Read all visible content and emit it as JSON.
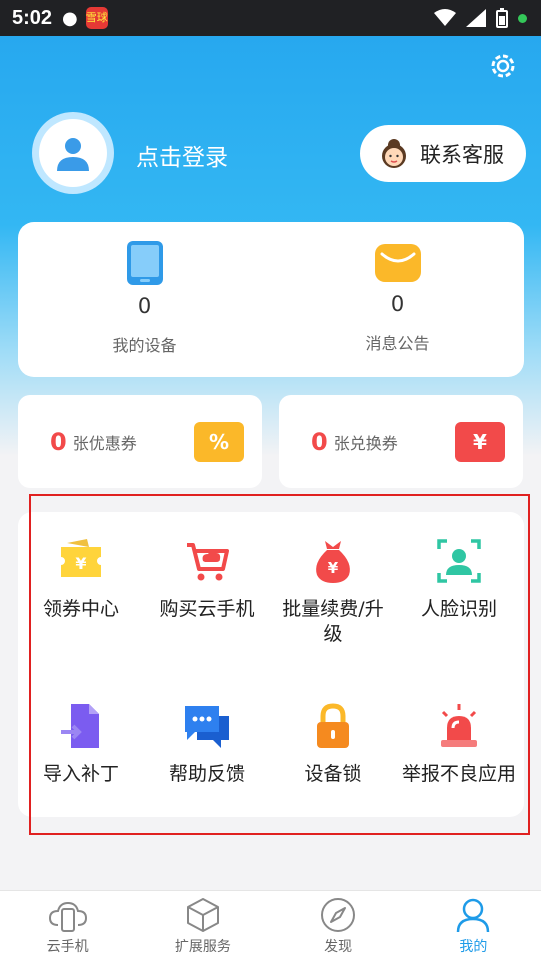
{
  "status_bar": {
    "time": "5:02",
    "app_badge": "雪球"
  },
  "header": {
    "login_text": "点击登录",
    "customer_service": "联系客服"
  },
  "stats": [
    {
      "value": "0",
      "label": "我的设备"
    },
    {
      "value": "0",
      "label": "消息公告"
    }
  ],
  "coupons": [
    {
      "value": "0",
      "label": "张优惠券",
      "tag": "%",
      "color": "#fbb829"
    },
    {
      "value": "0",
      "label": "张兑换券",
      "tag": "¥",
      "color": "#f24a4a"
    }
  ],
  "grid_items": [
    {
      "label": "领券中心",
      "icon": "ticket-icon"
    },
    {
      "label": "购买云手机",
      "icon": "cart-icon"
    },
    {
      "label": "批量续费/升级",
      "icon": "money-bag-icon"
    },
    {
      "label": "人脸识别",
      "icon": "face-scan-icon"
    },
    {
      "label": "导入补丁",
      "icon": "file-import-icon"
    },
    {
      "label": "帮助反馈",
      "icon": "chat-icon"
    },
    {
      "label": "设备锁",
      "icon": "lock-icon"
    },
    {
      "label": "举报不良应用",
      "icon": "alarm-icon"
    }
  ],
  "tabs": [
    {
      "label": "云手机",
      "icon": "cloud-phone-icon"
    },
    {
      "label": "扩展服务",
      "icon": "cube-icon"
    },
    {
      "label": "发现",
      "icon": "compass-icon"
    },
    {
      "label": "我的",
      "icon": "user-icon",
      "active": true
    }
  ],
  "colors": {
    "primary": "#1e9be8",
    "accent_red": "#f24a4a",
    "accent_yellow": "#fbb829"
  }
}
